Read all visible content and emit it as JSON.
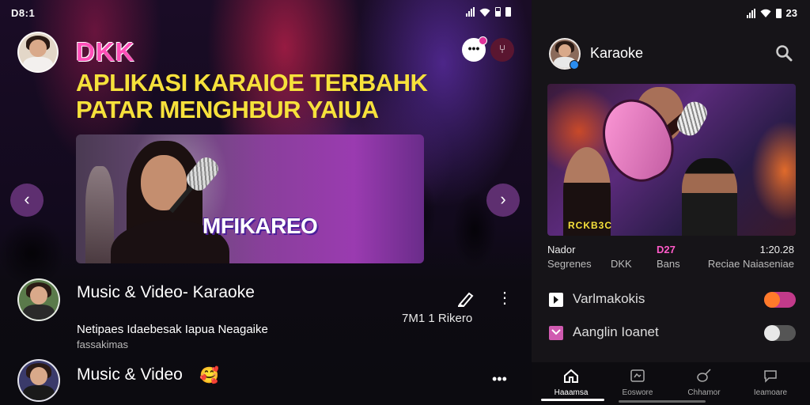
{
  "left": {
    "status": {
      "time": "D8:1"
    },
    "brand": "DKK",
    "headline_line1": "APLIKASI KARAIOE TERBAHK",
    "headline_line2": "PATAR MENGHBUR YAIUA",
    "hero_label": "MFIKAREO",
    "rows": [
      {
        "title": "Music & Video- Karaoke",
        "subtitle": "Netipaes Idaebesak Iapua Neagaike",
        "subtitle2": "fassakimas",
        "meta": "7M1 1 Rikero"
      },
      {
        "title": "Music & Video",
        "emoji": "🥰"
      }
    ]
  },
  "right": {
    "status": {
      "time": "23"
    },
    "title": "Karaoke",
    "card_tag": "RCKB3C",
    "info_row1": {
      "a": "Nador",
      "b": "D27",
      "c": "1:20.28"
    },
    "info_row2": {
      "a": "Segrenes",
      "b": "DKK",
      "c": "Bans",
      "d": "Reciae Naiaseniae"
    },
    "settings": [
      {
        "label": "Varlmakokis",
        "on": true,
        "accent": "#ff7a2a"
      },
      {
        "label": "Aanglin Ioanet",
        "on": false,
        "accent": "#d05ab0"
      }
    ],
    "nav": [
      {
        "label": "Haaamsa",
        "icon": "home-icon"
      },
      {
        "label": "Eoswore",
        "icon": "video-icon"
      },
      {
        "label": "Chhamor",
        "icon": "guitar-icon"
      },
      {
        "label": "Ieamoare",
        "icon": "chat-icon"
      }
    ]
  },
  "colors": {
    "brand_pink": "#ff4fb8",
    "headline_yellow": "#f6e13b",
    "accent_purple": "#8a3f9c"
  }
}
